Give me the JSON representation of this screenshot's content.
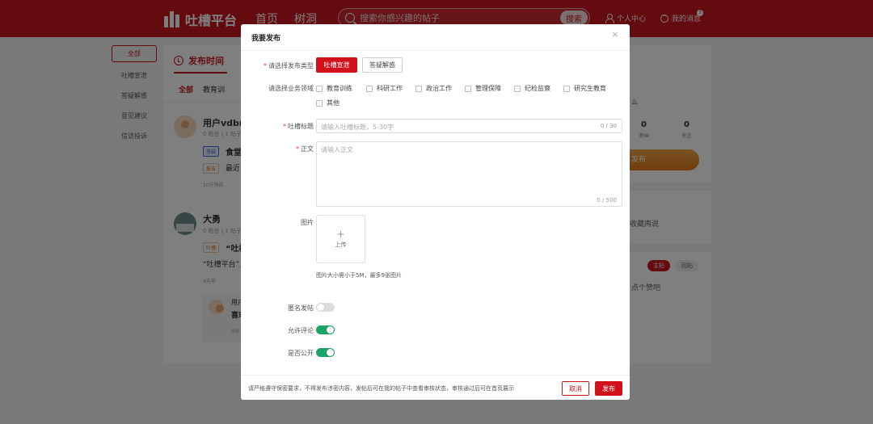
{
  "header": {
    "logo_text": "吐槽平台",
    "nav": [
      "首页",
      "树洞"
    ],
    "search_placeholder": "搜索你感兴趣的帖子",
    "search_button": "搜索",
    "user_center": "个人中心",
    "my_messages": "我的消息",
    "message_badge": "3"
  },
  "sidebar": {
    "items": [
      "全部",
      "吐槽宣泄",
      "答疑解惑",
      "意见建议",
      "信访投诉"
    ]
  },
  "feed": {
    "tab_label": "发布时间",
    "filters": [
      "全部",
      "教育训"
    ],
    "posts": [
      {
        "user": "用户vdbr",
        "meta": "0 粉丝 | 1 帖子",
        "tag1": "答疑",
        "title": "食堂",
        "tag2": "报告",
        "text": "最近",
        "time": "10分钟前"
      },
      {
        "user": "大勇",
        "meta": "0 粉丝 | 1 帖子",
        "tag1": "吐槽",
        "title": "“吐槽",
        "text": "“吐槽平台”上",
        "time": "4天前"
      }
    ],
    "reply": {
      "user": "用户",
      "text": "喜欢",
      "time": "9分"
    }
  },
  "right_panel": {
    "caption": "么",
    "stats": [
      {
        "value": "0",
        "label": "粉丝"
      },
      {
        "value": "0",
        "label": "关注"
      }
    ],
    "publish_button": "发布",
    "collect_hint": "收藏再说",
    "tabs": [
      "主贴",
      "回贴"
    ],
    "like_hint": "点个赞吧"
  },
  "modal": {
    "title": "我要发布",
    "type_label": "请选择发布类型",
    "types": [
      "吐槽宣泄",
      "答疑解惑"
    ],
    "domain_label": "请选择业务领域",
    "domains": [
      "教育训练",
      "科研工作",
      "政治工作",
      "管理保障",
      "纪检监察",
      "研究生教育",
      "其他"
    ],
    "title_label": "吐槽标题",
    "title_placeholder": "请输入吐槽标题，5-30字",
    "title_counter": "0 / 30",
    "body_label": "正文",
    "body_placeholder": "请输入正文",
    "body_counter": "0 / 500",
    "image_label": "图片",
    "upload_label": "上传",
    "image_hint": "图片大小需小于5M，最多9张图片",
    "anonymous_label": "匿名发帖",
    "allow_comment_label": "允许评论",
    "public_label": "是否公开",
    "anonymous_on": false,
    "allow_comment_on": true,
    "public_on": true,
    "footer_note": "请严格遵守保密要求，不得发布涉密内容，发帖后可在我的帖子中查看审核状态，审核通过后可在首页展示",
    "cancel": "取消",
    "publish": "发布"
  },
  "colors": {
    "brand_red": "#c9171e",
    "switch_on": "#1aa468",
    "overlay": "rgba(0,0,0,0.5)"
  }
}
